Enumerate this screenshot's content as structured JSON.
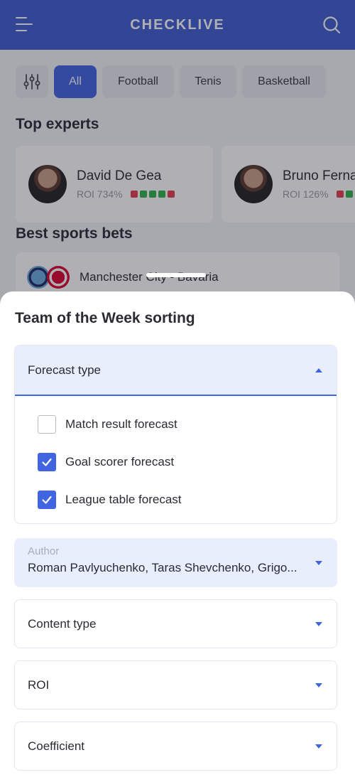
{
  "app": {
    "title": "CHECKLIVE"
  },
  "filters": {
    "items": [
      {
        "label": "All",
        "active": true
      },
      {
        "label": "Football",
        "active": false
      },
      {
        "label": "Tenis",
        "active": false
      },
      {
        "label": "Basketball",
        "active": false
      }
    ]
  },
  "experts": {
    "heading": "Top experts",
    "items": [
      {
        "name": "David De Gea",
        "roi": "ROI 734%",
        "form": [
          "r",
          "g",
          "g",
          "g",
          "r"
        ]
      },
      {
        "name": "Bruno Fernandes",
        "roi": "ROI 126%",
        "form": [
          "r",
          "g",
          "r"
        ]
      }
    ]
  },
  "bets": {
    "heading": "Best sports bets",
    "items": [
      {
        "match": "Manchester City - Bavaria"
      }
    ]
  },
  "sheet": {
    "title": "Team of the Week sorting",
    "forecast": {
      "label": "Forecast type",
      "expanded": true,
      "options": [
        {
          "label": "Match result forecast",
          "checked": false
        },
        {
          "label": "Goal scorer forecast",
          "checked": true
        },
        {
          "label": "League table forecast",
          "checked": true
        }
      ]
    },
    "author": {
      "label": "Author",
      "value": "Roman Pavlyuchenko, Taras Shevchenko, Grigo..."
    },
    "content_type": {
      "label": "Content type"
    },
    "roi": {
      "label": "ROI"
    },
    "coefficient": {
      "label": "Coefficient"
    }
  },
  "colors": {
    "accent": "#4164e0",
    "header": "#3f5fd0",
    "selected_bg": "#e9eefc"
  }
}
